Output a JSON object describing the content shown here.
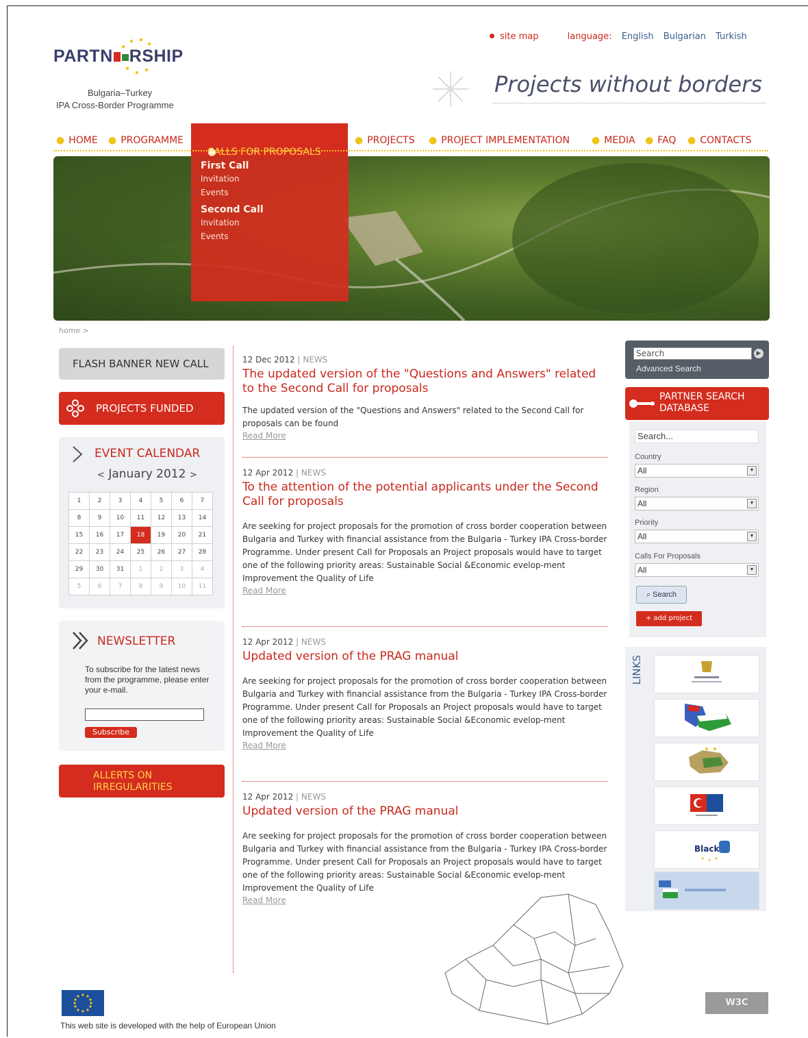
{
  "header": {
    "logo_word_1": "PARTN",
    "logo_word_2": "RSHIP",
    "logo_sub_1": "Bulgaria–Turkey",
    "logo_sub_2": "IPA Cross-Border Programme",
    "site_map": "site map",
    "language_label": "language:",
    "languages": [
      "English",
      "Bulgarian",
      "Turkish"
    ],
    "tagline": "Projects without borders"
  },
  "nav": {
    "items": [
      "HOME",
      "PROGRAMME",
      "CALLS FOR PROPOSALS",
      "PROJECTS",
      "PROJECT IMPLEMENTATION",
      "MEDIA",
      "FAQ",
      "CONTACTS"
    ],
    "active": "CALLS FOR PROPOSALS",
    "dropdown": {
      "first_call": "First Call",
      "first_invitation": "Invitation",
      "first_events": "Events",
      "second_call": "Second Call",
      "second_invitation": "Invitation",
      "second_events": "Events"
    }
  },
  "breadcrumb": "home >",
  "left": {
    "flash_banner": "FLASH BANNER NEW CALL",
    "projects_funded": "PROJECTS FUNDED",
    "calendar": {
      "title": "EVENT CALENDAR",
      "month": "January 2012",
      "prev": "<",
      "next": ">",
      "weeks": [
        [
          "1",
          "2",
          "3",
          "4",
          "5",
          "6",
          "7"
        ],
        [
          "8",
          "9",
          "10",
          "11",
          "12",
          "13",
          "14"
        ],
        [
          "15",
          "16",
          "17",
          "18",
          "19",
          "20",
          "21"
        ],
        [
          "22",
          "23",
          "24",
          "25",
          "26",
          "27",
          "28"
        ],
        [
          "29",
          "30",
          "31",
          "1",
          "2",
          "3",
          "4"
        ],
        [
          "5",
          "6",
          "7",
          "8",
          "9",
          "10",
          "11"
        ]
      ],
      "today": "18"
    },
    "newsletter": {
      "title": "NEWSLETTER",
      "text": "To subscribe for the latest news from the programme, please enter your e-mail.",
      "button": "Subscribe"
    },
    "allerts": "ALLERTS ON IRREGULARITIES"
  },
  "articles": [
    {
      "date": "12 Dec 2012",
      "tag": "| NEWS",
      "title": "The updated version of the \"Questions and Answers\" related to the Second Call for proposals",
      "body": "The updated version of the \"Questions and Answers\" related to the Second Call for proposals can be found",
      "more": "Read More"
    },
    {
      "date": "12 Apr 2012",
      "tag": "| NEWS",
      "title": "To the attention of the potential applicants under the Second Call for proposals",
      "body": "Are seeking for project proposals for the promotion of cross border cooperation between Bulgaria and Turkey with financial assistance from the Bulgaria - Turkey IPA Cross-border Programme. Under present Call for Proposals an Project proposals would have to target one of the following priority areas: Sustainable Social &Economic evelop-ment Improvement the Quality of Life",
      "more": "Read More"
    },
    {
      "date": "12 Apr 2012",
      "tag": "| NEWS",
      "title": "Updated version of the PRAG manual",
      "body": "Are seeking for project proposals for the promotion of cross border cooperation between Bulgaria and Turkey with financial assistance from the Bulgaria - Turkey IPA Cross-border Programme. Under present Call for Proposals an Project proposals would have to target one of the following priority areas: Sustainable Social &Economic evelop-ment Improvement the Quality of Life",
      "more": "Read More"
    },
    {
      "date": "12 Apr 2012",
      "tag": "| NEWS",
      "title": "Updated version of the PRAG manual",
      "body": "Are seeking for project proposals for the promotion of cross border cooperation between Bulgaria and Turkey with financial assistance from the Bulgaria - Turkey IPA Cross-border Programme. Under present Call for Proposals an Project proposals would have to target one of the following priority areas: Sustainable Social &Economic evelop-ment Improvement the Quality of Life",
      "more": "Read More"
    }
  ],
  "right": {
    "search_value": "Search",
    "advanced_search": "Advanced Search",
    "partner_title": "PARTNER SEARCH DATABASE",
    "partner_search_value": "Search...",
    "fields": [
      {
        "label": "Country",
        "value": "All"
      },
      {
        "label": "Region",
        "value": "All"
      },
      {
        "label": "Priority",
        "value": "All"
      },
      {
        "label": "Calls For Proposals",
        "value": "All"
      }
    ],
    "search_button": "Search",
    "add_project": "+ add project",
    "links_label": "LINKS"
  },
  "footer": {
    "text": "This web site is developed with the help of European Union",
    "badge": "W3C"
  },
  "colors": {
    "brand_red": "#d42c1e",
    "accent_yellow": "#f0c419",
    "link_blue": "#3a5e8c"
  }
}
